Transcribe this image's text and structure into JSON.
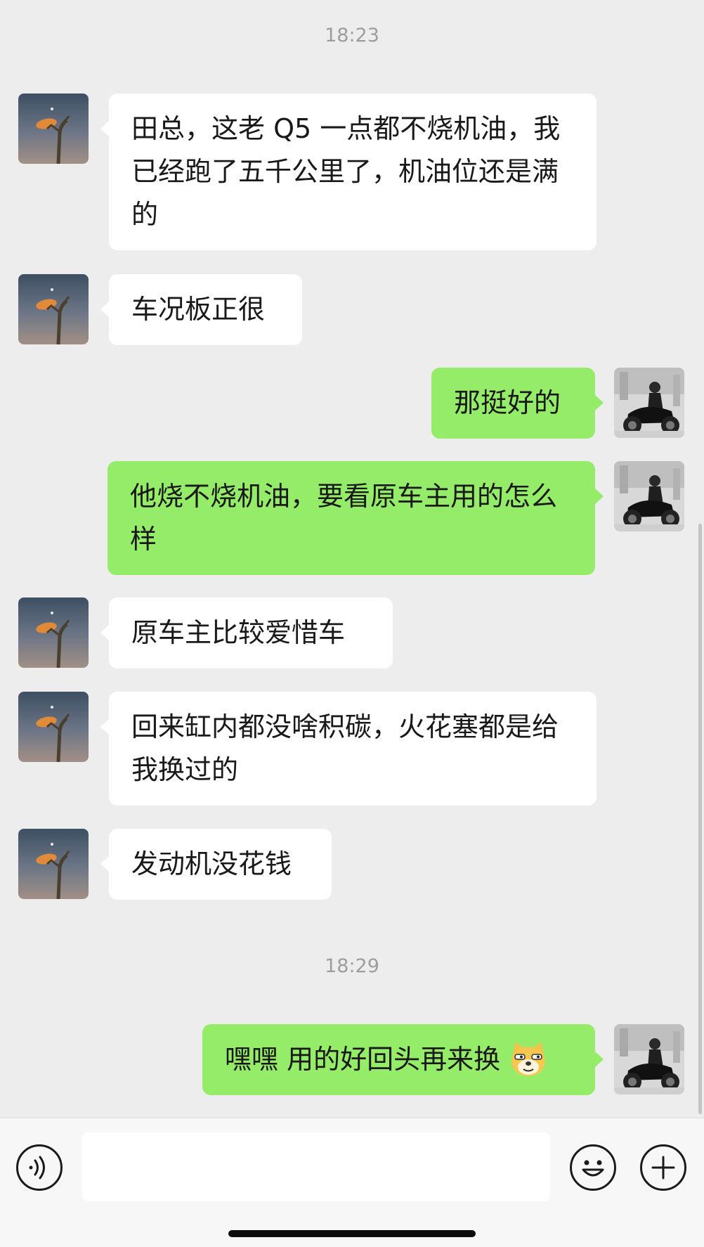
{
  "chat": {
    "timestamps": [
      "18:23",
      "18:29"
    ],
    "messages": [
      {
        "side": "in",
        "text": "田总，这老 Q5 一点都不烧机油，我已经跑了五千公里了，机油位还是满的",
        "avatar": "contact-avatar"
      },
      {
        "side": "in",
        "text": "车况板正很",
        "avatar": "contact-avatar"
      },
      {
        "side": "out",
        "text": "那挺好的",
        "avatar": "my-avatar"
      },
      {
        "side": "out",
        "text": "他烧不烧机油，要看原车主用的怎么样",
        "avatar": "my-avatar"
      },
      {
        "side": "in",
        "text": "原车主比较爱惜车",
        "avatar": "contact-avatar"
      },
      {
        "side": "in",
        "text": "回来缸内都没啥积碳，火花塞都是给我换过的",
        "avatar": "contact-avatar"
      },
      {
        "side": "in",
        "text": "发动机没花钱",
        "avatar": "contact-avatar"
      },
      {
        "side": "out",
        "text": "嘿嘿 用的好回头再来换",
        "emoji": "doge-emoji",
        "avatar": "my-avatar"
      }
    ]
  },
  "input_bar": {
    "voice_icon": "voice-icon",
    "emoji_icon": "smiley-icon",
    "plus_icon": "plus-icon",
    "placeholder": ""
  },
  "colors": {
    "background": "#ededed",
    "incoming_bubble": "#ffffff",
    "outgoing_bubble": "#95ec69"
  }
}
